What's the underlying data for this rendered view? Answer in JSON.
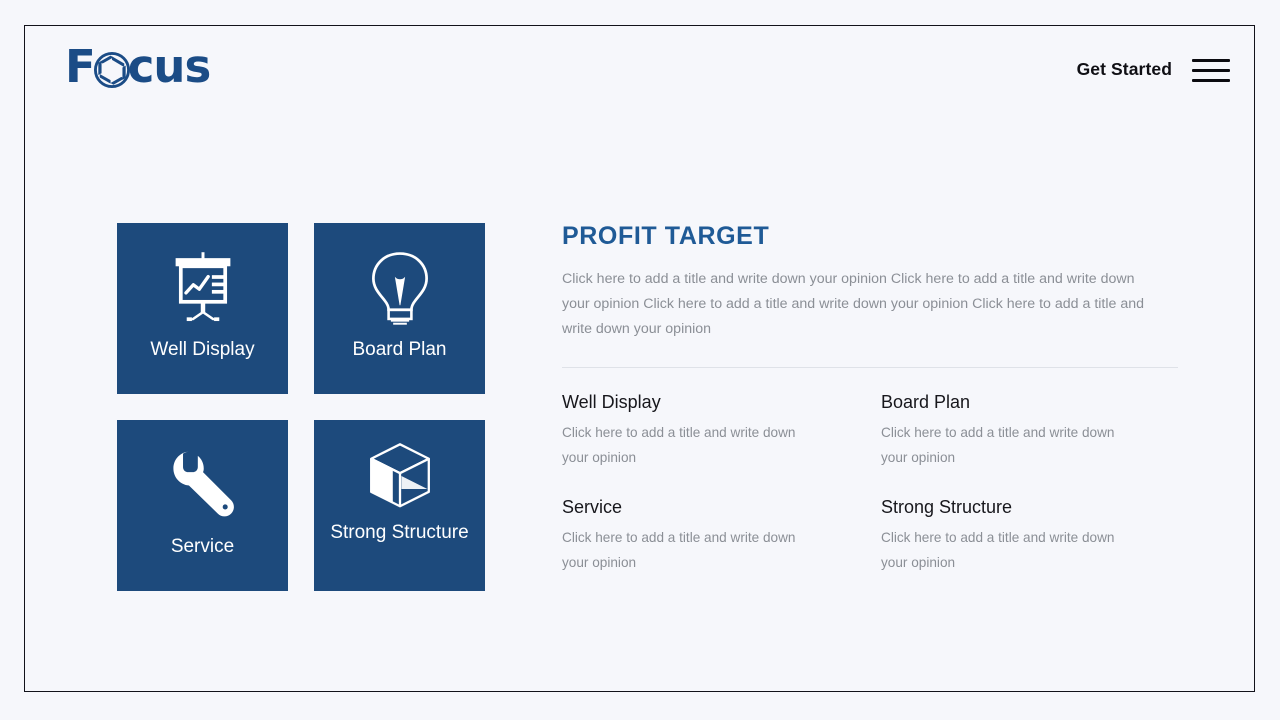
{
  "colors": {
    "page_background": "#f6f7fb",
    "frame_border": "#12121a",
    "tile_blue": "#1d4a7c",
    "brand_blue": "#1b4c86",
    "heading_blue": "#1f5a96",
    "body_text_gray": "#8b8f96",
    "divider_gray": "#dfe2e8",
    "tile_icon_white": "#ffffff"
  },
  "header": {
    "brand": {
      "text_before": "F",
      "aperture_icon": "camera-aperture-icon",
      "text_after": "cus",
      "full_name": "Focus"
    },
    "get_started_label": "Get Started",
    "menu_icon": "hamburger-menu-icon"
  },
  "tiles": [
    {
      "label": "Well Display",
      "icon": "presentation-chart-icon"
    },
    {
      "label": "Board Plan",
      "icon": "lightbulb-icon"
    },
    {
      "label": "Service",
      "icon": "wrench-icon"
    },
    {
      "label": "Strong Structure",
      "icon": "cube-icon"
    }
  ],
  "panel": {
    "title": "PROFIT TARGET",
    "intro": "Click here to add a title  and write down your opinion Click here to add a title and write down your opinion Click here to add a title  and write down your opinion Click here to add a title and write down your opinion"
  },
  "features": [
    {
      "title": "Well Display",
      "desc": "Click here to add a title  and write down your opinion"
    },
    {
      "title": "Board Plan",
      "desc": "Click here to add a title  and write down your opinion"
    },
    {
      "title": "Service",
      "desc": "Click here to add a title  and write down your opinion"
    },
    {
      "title": "Strong Structure",
      "desc": "Click here to add a title  and write down your opinion"
    }
  ]
}
